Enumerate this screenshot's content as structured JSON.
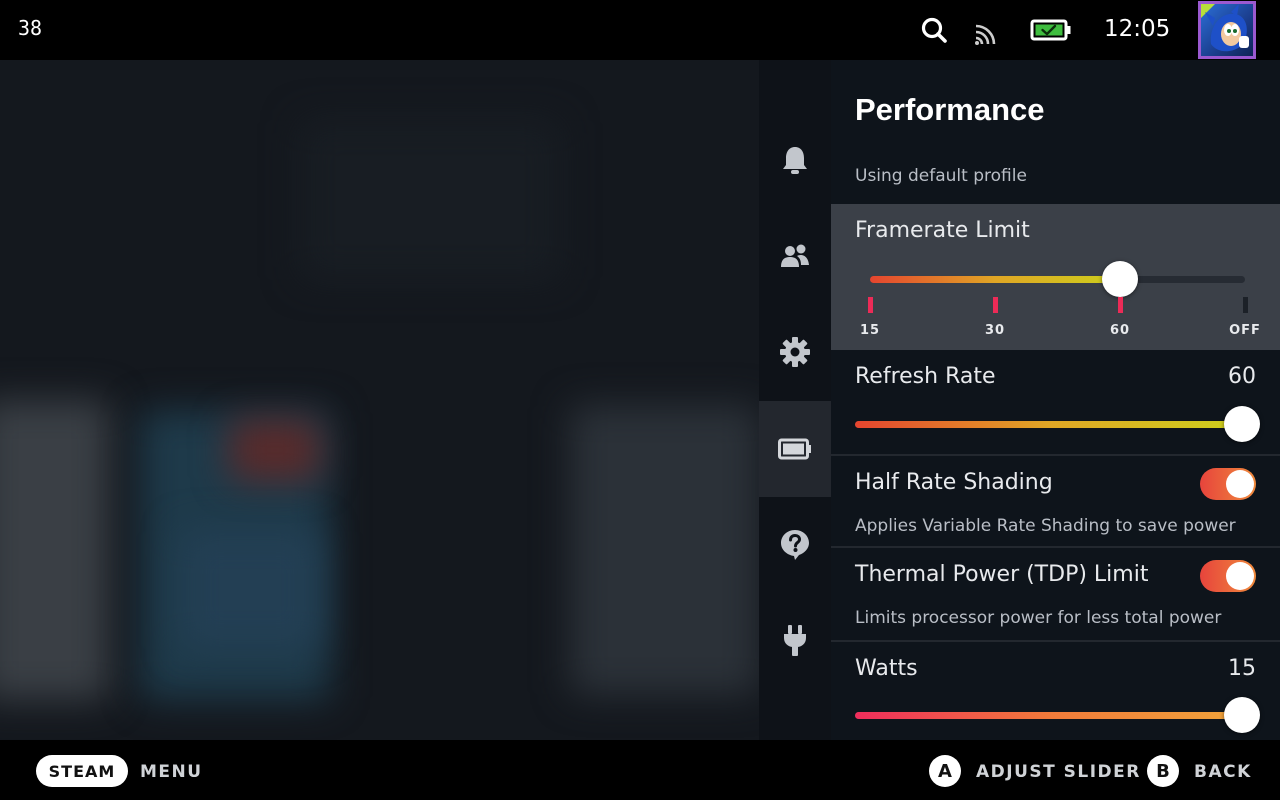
{
  "status_bar": {
    "fps_counter": "38",
    "clock": "12:05",
    "icons": [
      "search-icon",
      "cast-signal-icon",
      "battery-charging-icon",
      "avatar"
    ]
  },
  "sidebar": {
    "items": [
      {
        "icon": "bell-icon",
        "active": false
      },
      {
        "icon": "friends-icon",
        "active": false
      },
      {
        "icon": "gear-icon",
        "active": false
      },
      {
        "icon": "battery-icon",
        "active": true
      },
      {
        "icon": "help-icon",
        "active": false
      },
      {
        "icon": "power-plug-icon",
        "active": false
      }
    ]
  },
  "panel": {
    "title": "Performance",
    "profile_note": "Using default profile",
    "framerate": {
      "label": "Framerate Limit",
      "ticks": [
        "15",
        "30",
        "60",
        "OFF"
      ],
      "selected_index": 2
    },
    "refresh_rate": {
      "label": "Refresh Rate",
      "value": "60",
      "level": 1.0
    },
    "half_rate_shading": {
      "label": "Half Rate Shading",
      "description": "Applies Variable Rate Shading to save power",
      "enabled": true
    },
    "tdp_limit": {
      "label": "Thermal Power (TDP) Limit",
      "description": "Limits processor power for less total power",
      "enabled": true
    },
    "watts": {
      "label": "Watts",
      "value": "15",
      "level": 1.0
    }
  },
  "bottom_bar": {
    "steam_label": "STEAM",
    "menu_label": "MENU",
    "a_button": "A",
    "a_label": "ADJUST SLIDER",
    "b_button": "B",
    "b_label": "BACK"
  },
  "colors": {
    "accent_red": "#ec2b57",
    "accent_yellow": "#cdd01c",
    "highlight_row": "#3b4048",
    "avatar_border": "#9b59d0",
    "battery_green": "#3fbd3f"
  }
}
